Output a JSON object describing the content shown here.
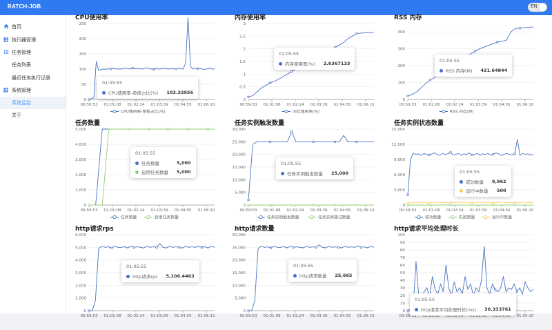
{
  "app": {
    "brand": "RATCH-JOB",
    "lang_toggle": "EN"
  },
  "sidebar": {
    "items": [
      {
        "label": "首页",
        "icon": "home-icon"
      },
      {
        "label": "执行器管理",
        "icon": "grid-icon"
      },
      {
        "label": "任务管理",
        "icon": "list-icon"
      },
      {
        "label": "任务列表",
        "icon": ""
      },
      {
        "label": "最近任务执行记录",
        "icon": ""
      },
      {
        "label": "系统管理",
        "icon": "grid-icon"
      },
      {
        "label": "系统监控",
        "icon": ""
      },
      {
        "label": "关于",
        "icon": ""
      }
    ],
    "active_index": 6
  },
  "colors": {
    "blue": "#4472c4",
    "green": "#91cc75",
    "yellow": "#fac858",
    "accent": "#2f7af0"
  },
  "panels": [
    {
      "title": "CPU使用率",
      "tooltip": {
        "time": "01:05:55",
        "rows": [
          {
            "name": "CPU使用率-单核占比(%)",
            "value": "103.32956",
            "color": "#4472c4"
          }
        ]
      },
      "chart_data": {
        "type": "line",
        "x_ticks": [
          "00:59:53",
          "01:01:08",
          "01:02:24",
          "01:03:39",
          "01:04:55",
          "01:06:10"
        ],
        "y_ticks": [
          "0",
          "50",
          "100",
          "150",
          "200",
          "250"
        ],
        "ylim": [
          0,
          250
        ],
        "series": [
          {
            "name": "CPU使用率-单核占比(%)",
            "color": "#4472c4",
            "values": [
              0,
              3,
              5,
              125,
              95,
              98,
              100,
              99,
              101,
              100,
              102,
              101,
              100,
              100,
              101,
              103,
              102,
              100,
              103,
              101,
              102,
              101,
              100,
              102,
              104,
              101,
              100,
              99,
              102,
              100,
              101,
              103,
              101,
              100,
              102,
              101,
              100,
              103,
              101,
              100,
              120,
              270,
              110,
              100,
              103,
              101,
              102,
              100,
              99,
              101,
              103,
              100,
              100
            ]
          }
        ]
      }
    },
    {
      "title": "内存使用率",
      "tooltip": {
        "time": "01:05:55",
        "rows": [
          {
            "name": "内存使用率(%)",
            "value": "2.6367133",
            "color": "#4472c4"
          }
        ]
      },
      "chart_data": {
        "type": "line",
        "x_ticks": [
          "00:59:53",
          "01:01:08",
          "01:02:24",
          "01:03:39",
          "01:04:55",
          "01:06:10"
        ],
        "y_ticks": [
          "0",
          "0.5",
          "1",
          "1.5",
          "2",
          "2.5",
          "3"
        ],
        "ylim": [
          0,
          3
        ],
        "series": [
          {
            "name": "内存使用率(%)",
            "color": "#4472c4",
            "values": [
              0.1,
              0.15,
              0.3,
              0.45,
              0.55,
              0.65,
              0.72,
              0.8,
              0.9,
              1.0,
              1.1,
              1.2,
              1.3,
              1.4,
              1.5,
              1.6,
              1.65,
              1.75,
              1.85,
              1.95,
              2.05,
              2.15,
              2.25,
              2.4,
              2.5,
              2.6,
              2.62,
              2.63,
              2.64,
              2.65
            ]
          }
        ]
      }
    },
    {
      "title": "RSS 内存",
      "tooltip": {
        "time": "01:05:55",
        "rows": [
          {
            "name": "RSS 内存(M)",
            "value": "421.64844",
            "color": "#4472c4"
          }
        ]
      },
      "chart_data": {
        "type": "line",
        "x_ticks": [
          "00:59:53",
          "01:01:08",
          "01:02:24",
          "01:03:39",
          "01:04:55",
          "01:06:10"
        ],
        "y_ticks": [
          "0",
          "100",
          "200",
          "300",
          "400"
        ],
        "ylim": [
          0,
          450
        ],
        "series": [
          {
            "name": "RSS 内存(M)",
            "color": "#4472c4",
            "values": [
              20,
              30,
              45,
              70,
              95,
              115,
              130,
              150,
              170,
              190,
              210,
              225,
              240,
              255,
              270,
              285,
              300,
              310,
              320,
              330,
              340,
              345,
              350,
              400,
              420,
              422,
              425,
              428,
              430
            ]
          }
        ]
      }
    },
    {
      "title": "任务数量",
      "tooltip": {
        "time": "01:05:55",
        "rows": [
          {
            "name": "任务数量",
            "value": "5,000",
            "color": "#4472c4"
          },
          {
            "name": "启用任务数量",
            "value": "5,000",
            "color": "#91cc75"
          }
        ]
      },
      "chart_data": {
        "type": "line",
        "x_ticks": [
          "00:59:53",
          "01:01:08",
          "01:02:24",
          "01:03:39",
          "01:04:55",
          "01:06:10"
        ],
        "y_ticks": [
          "0",
          "1,000",
          "2,000",
          "3,000",
          "4,000",
          "5,000"
        ],
        "ylim": [
          0,
          5000
        ],
        "series": [
          {
            "name": "任务数量",
            "color": "#4472c4",
            "values": [
              0,
              0,
              5000,
              5000,
              5000,
              5000,
              5000,
              5000,
              5000,
              5000,
              5000,
              5000,
              5000,
              5000,
              5000,
              5000,
              5000,
              5000,
              5000,
              5000
            ]
          },
          {
            "name": "启用任务数量",
            "color": "#91cc75",
            "values": [
              0,
              0,
              0,
              5000,
              5000,
              5000,
              5000,
              5000,
              5000,
              5000,
              5000,
              5000,
              5000,
              5000,
              5000,
              5000,
              5000,
              5000,
              5000,
              5000
            ]
          }
        ]
      }
    },
    {
      "title": "任务实例触发数量",
      "tooltip": {
        "time": "01:05:55",
        "rows": [
          {
            "name": "任务实例触发数量",
            "value": "25,000",
            "color": "#4472c4"
          }
        ]
      },
      "chart_data": {
        "type": "line",
        "x_ticks": [
          "00:59:53",
          "01:01:08",
          "01:02:24",
          "01:03:39",
          "01:04:55",
          "01:06:10"
        ],
        "y_ticks": [
          "0",
          "5,000",
          "10,000",
          "15,000",
          "20,000",
          "25,000",
          "30,000"
        ],
        "ylim": [
          0,
          30000
        ],
        "series": [
          {
            "name": "任务实例触发数量",
            "color": "#4472c4",
            "values": [
              2000,
              24000,
              25000,
              25000,
              25000,
              25000,
              25000,
              25000,
              25000,
              25000,
              29000,
              25000,
              25000,
              25000,
              25000,
              25000,
              25000,
              25000,
              25000,
              25000,
              25000,
              25000,
              27500,
              25000,
              25000,
              25000,
              25000,
              25000,
              25000,
              25000
            ]
          },
          {
            "name": "任务实例重试数量",
            "color": "#91cc75",
            "values": [
              0,
              0,
              0,
              0,
              0,
              0,
              0,
              0,
              0,
              0,
              0,
              0,
              0,
              0,
              0,
              0,
              0,
              0,
              0,
              0,
              0,
              0,
              0,
              0,
              0,
              0,
              0,
              0,
              0,
              0
            ]
          }
        ]
      }
    },
    {
      "title": "任务实例状态数量",
      "tooltip": {
        "time": "01:05:55",
        "rows": [
          {
            "name": "成功数量",
            "value": "9,962",
            "color": "#4472c4"
          },
          {
            "name": "运行中数量",
            "value": "500",
            "color": "#fac858"
          }
        ]
      },
      "chart_data": {
        "type": "line",
        "x_ticks": [
          "00:59:53",
          "01:01:08",
          "01:02:24",
          "01:03:39",
          "01:04:55",
          "01:06:10"
        ],
        "y_ticks": [
          "0",
          "3,000",
          "6,000",
          "9,000",
          "12,000",
          "15,000"
        ],
        "ylim": [
          0,
          15000
        ],
        "series": [
          {
            "name": "成功数量",
            "color": "#4472c4",
            "values": [
              2000,
              9000,
              10200,
              10000,
              10100,
              9800,
              10200,
              10000,
              9900,
              10100,
              10300,
              10000,
              9800,
              10200,
              10000,
              10100,
              10400,
              9900,
              10000,
              10200,
              9800,
              10100,
              10000,
              10300,
              9900,
              10000,
              10200,
              9800,
              10100,
              10000,
              10200,
              9900,
              10000,
              10300,
              10100,
              9800,
              10000,
              10200,
              10000,
              9900,
              10100,
              13000,
              9800,
              10200,
              10000,
              10100,
              9900,
              10000
            ]
          },
          {
            "name": "失败数量",
            "color": "#91cc75",
            "values": [
              0,
              0,
              0,
              0,
              0,
              0,
              0,
              0,
              0,
              0,
              0,
              0,
              0,
              0,
              0,
              0,
              0,
              0,
              0,
              0,
              0,
              0,
              0,
              0,
              0,
              0,
              0,
              0,
              0,
              0,
              0,
              0,
              0,
              0,
              0,
              0,
              0,
              0,
              0,
              0,
              0,
              0,
              0,
              0,
              0,
              0,
              0,
              0
            ]
          },
          {
            "name": "运行中数量",
            "color": "#fac858",
            "values": [
              300,
              500,
              400,
              600,
              500,
              450,
              550,
              500,
              480,
              520,
              500,
              600,
              500,
              450,
              550,
              500,
              480,
              520,
              500,
              600,
              500,
              450,
              550,
              500,
              480,
              520,
              500,
              600,
              500,
              450,
              550,
              500,
              480,
              520,
              500,
              600,
              500,
              450,
              550,
              500,
              480,
              520,
              500,
              600,
              500,
              450,
              550,
              500
            ]
          }
        ]
      }
    },
    {
      "title": "http请求rps",
      "tooltip": {
        "time": "01:05:55",
        "rows": [
          {
            "name": "http请求rps",
            "value": "5,106.4463",
            "color": "#4472c4"
          }
        ]
      },
      "chart_data": {
        "type": "line",
        "x_ticks": [
          "00:59:53",
          "01:01:08",
          "01:02:24",
          "01:03:39",
          "01:04:55",
          "01:06:10"
        ],
        "y_ticks": [
          "0",
          "1,000",
          "2,000",
          "3,000",
          "4,000",
          "5,000",
          "6,000"
        ],
        "ylim": [
          0,
          6000
        ],
        "series": [
          {
            "name": "http请求rps",
            "color": "#4472c4",
            "values": [
              0,
              0,
              800,
              4900,
              5100,
              5000,
              5050,
              4950,
              5100,
              5000,
              5000,
              5050,
              4950,
              5100,
              5000,
              5050,
              5000,
              4950,
              5100,
              5000,
              5050,
              5000,
              5300,
              5000,
              4950,
              5100,
              5000,
              5050,
              5000,
              4950,
              5100,
              5000,
              5050,
              5000,
              5106,
              5000,
              5050,
              4950,
              5100,
              5000
            ]
          }
        ]
      }
    },
    {
      "title": "http请求数量",
      "tooltip": {
        "time": "01:05:55",
        "rows": [
          {
            "name": "http请求数量",
            "value": "25,665",
            "color": "#4472c4"
          }
        ]
      },
      "chart_data": {
        "type": "line",
        "x_ticks": [
          "00:59:53",
          "01:01:08",
          "01:02:24",
          "01:03:39",
          "01:04:55",
          "01:06:10"
        ],
        "y_ticks": [
          "0",
          "5,000",
          "10,000",
          "15,000",
          "20,000",
          "25,000",
          "30,000"
        ],
        "ylim": [
          0,
          30000
        ],
        "series": [
          {
            "name": "http请求数量",
            "color": "#4472c4",
            "values": [
              0,
              0,
              4000,
              24500,
              25500,
              25000,
              25200,
              24800,
              25500,
              25000,
              25000,
              25300,
              24800,
              25500,
              25000,
              25200,
              25000,
              24800,
              25500,
              25000,
              25200,
              25000,
              26000,
              25000,
              24800,
              25500,
              25000,
              25200,
              25000,
              24800,
              25500,
              25000,
              25200,
              25000,
              25665,
              25000,
              25200,
              24800,
              25500,
              25000
            ]
          }
        ]
      }
    },
    {
      "title": "http请求平均处理时长",
      "tooltip": {
        "time": "01:05:55",
        "rows": [
          {
            "name": "http请求平均处理时长(ms)",
            "value": "30.333761",
            "color": "#4472c4"
          }
        ]
      },
      "chart_data": {
        "type": "line",
        "x_ticks": [
          "00:59:53",
          "01:01:08",
          "01:02:24",
          "01:03:39",
          "01:04:55",
          "01:06:10"
        ],
        "y_ticks": [
          "0",
          "10",
          "20",
          "30",
          "40",
          "50",
          "60",
          "70",
          "80",
          "90",
          "100"
        ],
        "ylim": [
          0,
          100
        ],
        "series": [
          {
            "name": "http请求平均处理时长(ms)",
            "color": "#4472c4",
            "values": [
              0,
              2,
              5,
              65,
              20,
              15,
              25,
              30,
              18,
              45,
              28,
              22,
              35,
              25,
              60,
              30,
              20,
              38,
              25,
              30,
              22,
              45,
              28,
              35,
              20,
              30,
              25,
              40,
              85,
              30,
              22,
              35,
              28,
              25,
              30,
              45,
              25,
              30,
              28,
              35,
              25,
              30,
              22,
              38,
              30,
              25,
              28
            ]
          }
        ]
      }
    }
  ]
}
